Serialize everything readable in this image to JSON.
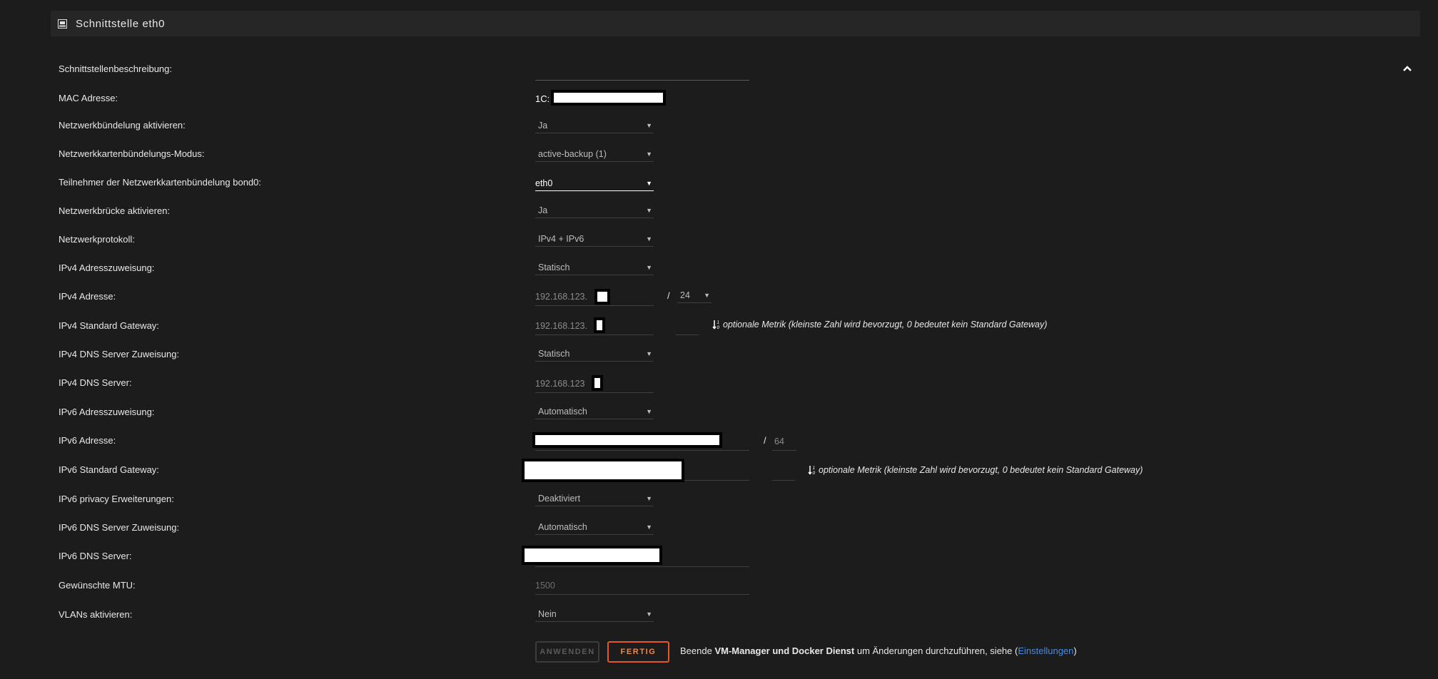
{
  "panel": {
    "title": "Schnittstelle eth0",
    "icon": "network-interface-icon"
  },
  "rows": [
    {
      "key": "desc",
      "label": "Schnittstellenbeschreibung:"
    },
    {
      "key": "mac",
      "label": "MAC Adresse:",
      "value_prefix": "1C:"
    },
    {
      "key": "bond",
      "label": "Netzwerkbündelung aktivieren:",
      "value": "Ja"
    },
    {
      "key": "bond_mode",
      "label": "Netzwerkkartenbündelungs-Modus:",
      "value": "active-backup (1)"
    },
    {
      "key": "bond_members",
      "label": "Teilnehmer der Netzwerkkartenbündelung bond0:",
      "value": "eth0"
    },
    {
      "key": "bridge",
      "label": "Netzwerkbrücke aktivieren:",
      "value": "Ja"
    },
    {
      "key": "protocol",
      "label": "Netzwerkprotokoll:",
      "value": "IPv4 + IPv6"
    },
    {
      "key": "ipv4_assign",
      "label": "IPv4 Adresszuweisung:",
      "value": "Statisch"
    },
    {
      "key": "ipv4_addr",
      "label": "IPv4 Adresse:",
      "value": "192.168.123.",
      "netmask": "24"
    },
    {
      "key": "ipv4_gw",
      "label": "IPv4 Standard Gateway:",
      "value": "192.168.123."
    },
    {
      "key": "ipv4_dns_assign",
      "label": "IPv4 DNS Server Zuweisung:",
      "value": "Statisch"
    },
    {
      "key": "ipv4_dns",
      "label": "IPv4 DNS Server:",
      "value": "192.168.123"
    },
    {
      "key": "ipv6_assign",
      "label": "IPv6 Adresszuweisung:",
      "value": "Automatisch"
    },
    {
      "key": "ipv6_addr",
      "label": "IPv6 Adresse:",
      "prefix_len": "64"
    },
    {
      "key": "ipv6_gw",
      "label": "IPv6 Standard Gateway:"
    },
    {
      "key": "ipv6_privacy",
      "label": "IPv6 privacy Erweiterungen:",
      "value": "Deaktiviert"
    },
    {
      "key": "ipv6_dns_assign",
      "label": "IPv6 DNS Server Zuweisung:",
      "value": "Automatisch"
    },
    {
      "key": "ipv6_dns",
      "label": "IPv6 DNS Server:"
    },
    {
      "key": "mtu",
      "label": "Gewünschte MTU:",
      "placeholder": "1500"
    },
    {
      "key": "vlans",
      "label": "VLANs aktivieren:",
      "value": "Nein"
    }
  ],
  "metric_note": "optionale Metrik (kleinste Zahl wird bevorzugt, 0 bedeutet kein Standard Gateway)",
  "buttons": {
    "apply": "ANWENDEN",
    "done": "FERTIG"
  },
  "footer": {
    "pre": "Beende",
    "bold": "VM-Manager und Docker Dienst",
    "mid": "um Änderungen durchzuführen, siehe (",
    "link": "Einstellungen",
    "post": ")"
  }
}
